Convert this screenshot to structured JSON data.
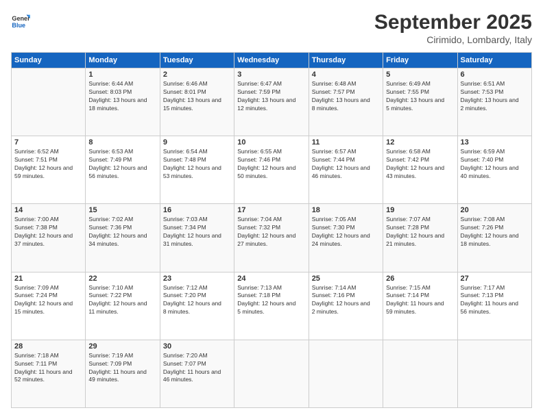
{
  "logo": {
    "line1": "General",
    "line2": "Blue"
  },
  "title": "September 2025",
  "location": "Cirimido, Lombardy, Italy",
  "weekdays": [
    "Sunday",
    "Monday",
    "Tuesday",
    "Wednesday",
    "Thursday",
    "Friday",
    "Saturday"
  ],
  "weeks": [
    [
      {
        "date": "",
        "sunrise": "",
        "sunset": "",
        "daylight": ""
      },
      {
        "date": "1",
        "sunrise": "Sunrise: 6:44 AM",
        "sunset": "Sunset: 8:03 PM",
        "daylight": "Daylight: 13 hours and 18 minutes."
      },
      {
        "date": "2",
        "sunrise": "Sunrise: 6:46 AM",
        "sunset": "Sunset: 8:01 PM",
        "daylight": "Daylight: 13 hours and 15 minutes."
      },
      {
        "date": "3",
        "sunrise": "Sunrise: 6:47 AM",
        "sunset": "Sunset: 7:59 PM",
        "daylight": "Daylight: 13 hours and 12 minutes."
      },
      {
        "date": "4",
        "sunrise": "Sunrise: 6:48 AM",
        "sunset": "Sunset: 7:57 PM",
        "daylight": "Daylight: 13 hours and 8 minutes."
      },
      {
        "date": "5",
        "sunrise": "Sunrise: 6:49 AM",
        "sunset": "Sunset: 7:55 PM",
        "daylight": "Daylight: 13 hours and 5 minutes."
      },
      {
        "date": "6",
        "sunrise": "Sunrise: 6:51 AM",
        "sunset": "Sunset: 7:53 PM",
        "daylight": "Daylight: 13 hours and 2 minutes."
      }
    ],
    [
      {
        "date": "7",
        "sunrise": "Sunrise: 6:52 AM",
        "sunset": "Sunset: 7:51 PM",
        "daylight": "Daylight: 12 hours and 59 minutes."
      },
      {
        "date": "8",
        "sunrise": "Sunrise: 6:53 AM",
        "sunset": "Sunset: 7:49 PM",
        "daylight": "Daylight: 12 hours and 56 minutes."
      },
      {
        "date": "9",
        "sunrise": "Sunrise: 6:54 AM",
        "sunset": "Sunset: 7:48 PM",
        "daylight": "Daylight: 12 hours and 53 minutes."
      },
      {
        "date": "10",
        "sunrise": "Sunrise: 6:55 AM",
        "sunset": "Sunset: 7:46 PM",
        "daylight": "Daylight: 12 hours and 50 minutes."
      },
      {
        "date": "11",
        "sunrise": "Sunrise: 6:57 AM",
        "sunset": "Sunset: 7:44 PM",
        "daylight": "Daylight: 12 hours and 46 minutes."
      },
      {
        "date": "12",
        "sunrise": "Sunrise: 6:58 AM",
        "sunset": "Sunset: 7:42 PM",
        "daylight": "Daylight: 12 hours and 43 minutes."
      },
      {
        "date": "13",
        "sunrise": "Sunrise: 6:59 AM",
        "sunset": "Sunset: 7:40 PM",
        "daylight": "Daylight: 12 hours and 40 minutes."
      }
    ],
    [
      {
        "date": "14",
        "sunrise": "Sunrise: 7:00 AM",
        "sunset": "Sunset: 7:38 PM",
        "daylight": "Daylight: 12 hours and 37 minutes."
      },
      {
        "date": "15",
        "sunrise": "Sunrise: 7:02 AM",
        "sunset": "Sunset: 7:36 PM",
        "daylight": "Daylight: 12 hours and 34 minutes."
      },
      {
        "date": "16",
        "sunrise": "Sunrise: 7:03 AM",
        "sunset": "Sunset: 7:34 PM",
        "daylight": "Daylight: 12 hours and 31 minutes."
      },
      {
        "date": "17",
        "sunrise": "Sunrise: 7:04 AM",
        "sunset": "Sunset: 7:32 PM",
        "daylight": "Daylight: 12 hours and 27 minutes."
      },
      {
        "date": "18",
        "sunrise": "Sunrise: 7:05 AM",
        "sunset": "Sunset: 7:30 PM",
        "daylight": "Daylight: 12 hours and 24 minutes."
      },
      {
        "date": "19",
        "sunrise": "Sunrise: 7:07 AM",
        "sunset": "Sunset: 7:28 PM",
        "daylight": "Daylight: 12 hours and 21 minutes."
      },
      {
        "date": "20",
        "sunrise": "Sunrise: 7:08 AM",
        "sunset": "Sunset: 7:26 PM",
        "daylight": "Daylight: 12 hours and 18 minutes."
      }
    ],
    [
      {
        "date": "21",
        "sunrise": "Sunrise: 7:09 AM",
        "sunset": "Sunset: 7:24 PM",
        "daylight": "Daylight: 12 hours and 15 minutes."
      },
      {
        "date": "22",
        "sunrise": "Sunrise: 7:10 AM",
        "sunset": "Sunset: 7:22 PM",
        "daylight": "Daylight: 12 hours and 11 minutes."
      },
      {
        "date": "23",
        "sunrise": "Sunrise: 7:12 AM",
        "sunset": "Sunset: 7:20 PM",
        "daylight": "Daylight: 12 hours and 8 minutes."
      },
      {
        "date": "24",
        "sunrise": "Sunrise: 7:13 AM",
        "sunset": "Sunset: 7:18 PM",
        "daylight": "Daylight: 12 hours and 5 minutes."
      },
      {
        "date": "25",
        "sunrise": "Sunrise: 7:14 AM",
        "sunset": "Sunset: 7:16 PM",
        "daylight": "Daylight: 12 hours and 2 minutes."
      },
      {
        "date": "26",
        "sunrise": "Sunrise: 7:15 AM",
        "sunset": "Sunset: 7:14 PM",
        "daylight": "Daylight: 11 hours and 59 minutes."
      },
      {
        "date": "27",
        "sunrise": "Sunrise: 7:17 AM",
        "sunset": "Sunset: 7:13 PM",
        "daylight": "Daylight: 11 hours and 56 minutes."
      }
    ],
    [
      {
        "date": "28",
        "sunrise": "Sunrise: 7:18 AM",
        "sunset": "Sunset: 7:11 PM",
        "daylight": "Daylight: 11 hours and 52 minutes."
      },
      {
        "date": "29",
        "sunrise": "Sunrise: 7:19 AM",
        "sunset": "Sunset: 7:09 PM",
        "daylight": "Daylight: 11 hours and 49 minutes."
      },
      {
        "date": "30",
        "sunrise": "Sunrise: 7:20 AM",
        "sunset": "Sunset: 7:07 PM",
        "daylight": "Daylight: 11 hours and 46 minutes."
      },
      {
        "date": "",
        "sunrise": "",
        "sunset": "",
        "daylight": ""
      },
      {
        "date": "",
        "sunrise": "",
        "sunset": "",
        "daylight": ""
      },
      {
        "date": "",
        "sunrise": "",
        "sunset": "",
        "daylight": ""
      },
      {
        "date": "",
        "sunrise": "",
        "sunset": "",
        "daylight": ""
      }
    ]
  ]
}
